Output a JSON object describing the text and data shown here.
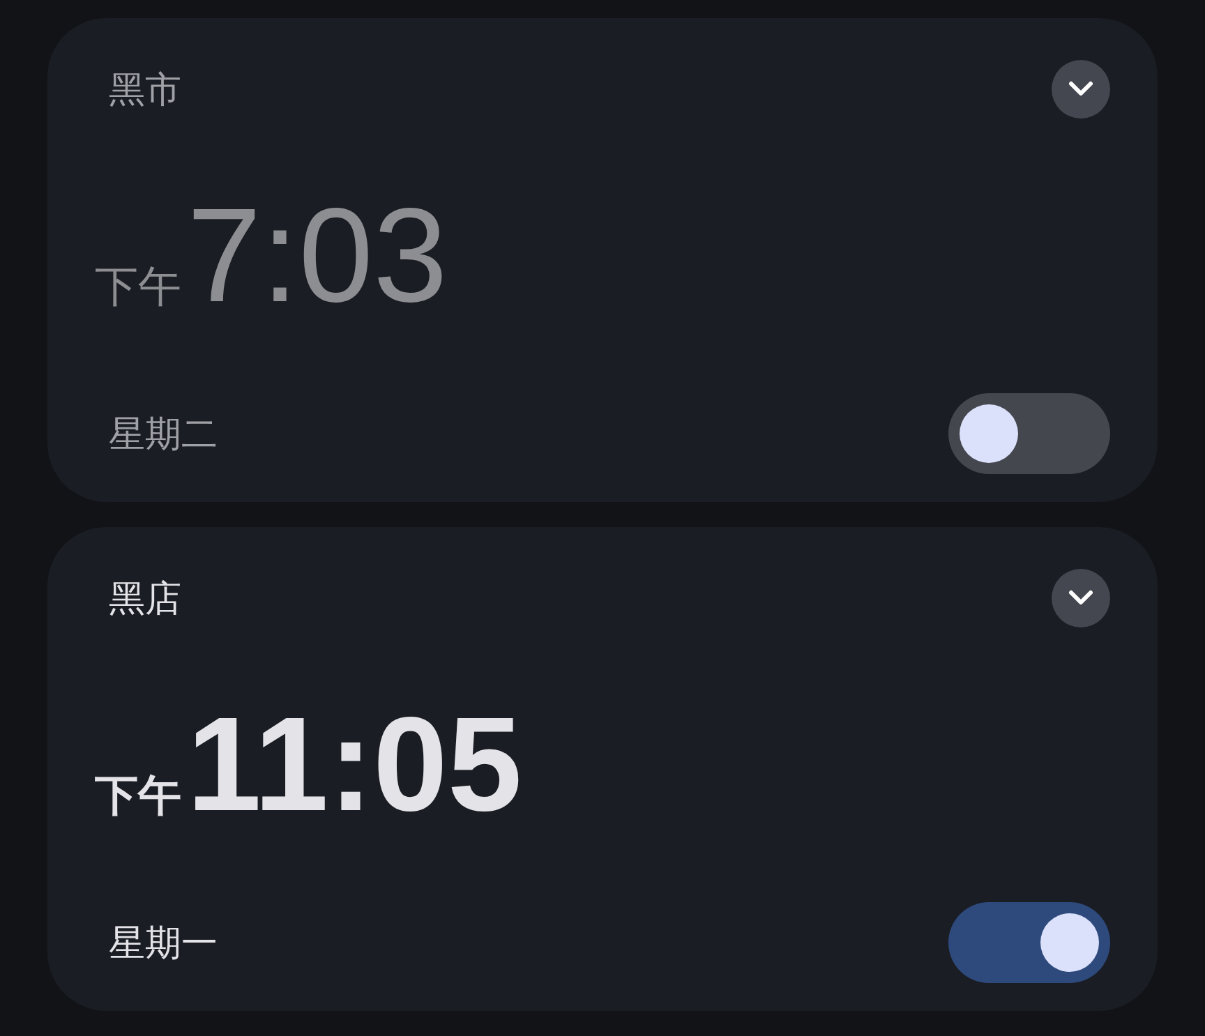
{
  "alarms": [
    {
      "label": "黑市",
      "expanded": false,
      "period": "下午",
      "time": "7:03",
      "days": "星期二",
      "on": false
    },
    {
      "label": "黑店",
      "expanded": false,
      "period": "下午",
      "time": "11:05",
      "days": "星期一",
      "on": true
    }
  ]
}
